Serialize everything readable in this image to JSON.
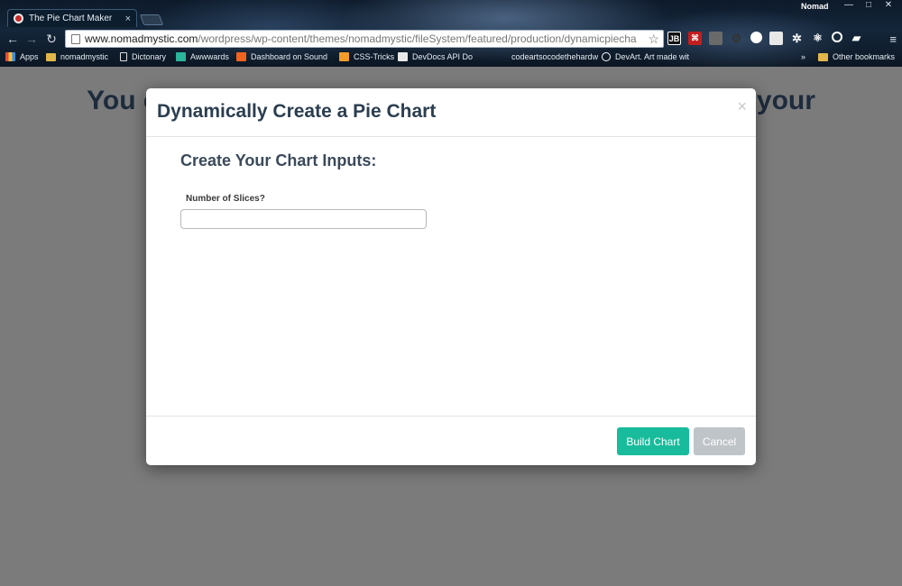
{
  "browser": {
    "tab_title": "The Pie Chart Maker",
    "tab_close": "×",
    "profile_name": "Nomad",
    "window_buttons": [
      "—",
      "□",
      "✕"
    ],
    "url_host": "www.nomadmystic.com",
    "url_path": "/wordpress/wp-content/themes/nomadmystic/fileSystem/featured/production/dynamicpiecha",
    "extension_labels": [
      "JB"
    ],
    "bookmarks": [
      {
        "label": "Apps",
        "icon": "apps-grid-icon"
      },
      {
        "label": "nomadmystic",
        "icon": "folder-icon"
      },
      {
        "label": "Dictonary",
        "icon": "page-icon"
      },
      {
        "label": "Awwwards",
        "icon": "awwwards-icon"
      },
      {
        "label": "Dashboard on Sound",
        "icon": "soundcloud-icon"
      },
      {
        "label": "CSS-Tricks",
        "icon": "css-tricks-icon"
      },
      {
        "label": "DevDocs API Do",
        "icon": "devdocs-icon"
      },
      {
        "label": "codeartsocodethehardw",
        "icon": "page-icon"
      },
      {
        "label": "DevArt. Art made wit",
        "icon": "devart-icon"
      }
    ],
    "bookmarks_overflow": "»",
    "other_bookmarks": "Other bookmarks"
  },
  "page": {
    "heading_left": "You ca",
    "heading_right": "n your"
  },
  "modal": {
    "title": "Dynamically Create a Pie Chart",
    "close_symbol": "×",
    "section_heading": "Create Your Chart Inputs:",
    "slices_label": "Number of Slices?",
    "slices_value": "",
    "build_button": "Build Chart",
    "cancel_button": "Cancel"
  },
  "colors": {
    "primary_button": "#18bc9c",
    "cancel_button": "#bfc4c8",
    "title_text": "#2b3e50",
    "overlay": "#7b7b7b"
  }
}
